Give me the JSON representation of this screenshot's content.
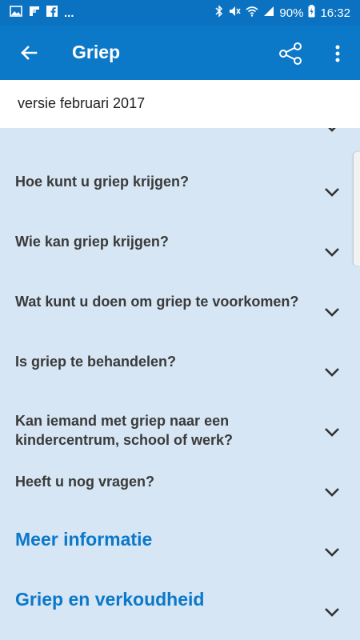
{
  "status_bar": {
    "left_icons": [
      "image-icon",
      "flipboard-icon",
      "facebook-icon"
    ],
    "more": "...",
    "battery": "90%",
    "time": "16:32"
  },
  "app_bar": {
    "title": "Griep"
  },
  "version": "versie februari 2017",
  "items": [
    {
      "label": "Hoe kunt u griep krijgen?",
      "type": "question"
    },
    {
      "label": "Wie kan griep krijgen?",
      "type": "question"
    },
    {
      "label": "Wat kunt u doen om griep te voorkomen?",
      "type": "question"
    },
    {
      "label": "Is griep te behandelen?",
      "type": "question"
    },
    {
      "label": "Kan iemand met griep naar een kindercentrum, school of werk?",
      "type": "question"
    },
    {
      "label": "Heeft u nog vragen?",
      "type": "question"
    },
    {
      "label": "Meer informatie",
      "type": "section"
    },
    {
      "label": "Griep en verkoudheid",
      "type": "section"
    }
  ],
  "colors": {
    "primary": "#0b78c8",
    "status_bar": "#0a72c0",
    "background": "#d6e6f4",
    "question_text": "#3a3a3a",
    "section_text": "#0b78c8"
  }
}
